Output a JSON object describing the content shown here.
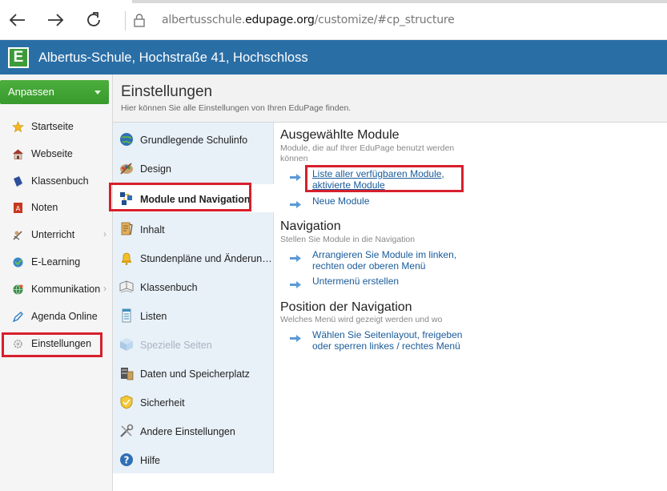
{
  "browser": {
    "url_prefix": "albertusschule.",
    "url_domain": "edupage.org",
    "url_path": "/customize/#cp_structure"
  },
  "header": {
    "logo_letter": "E",
    "school_title": "Albertus-Schule, Hochstraße 41, Hochschloss"
  },
  "sidebar": {
    "customize_label": "Anpassen",
    "items": [
      {
        "label": "Startseite",
        "icon": "star-icon"
      },
      {
        "label": "Webseite",
        "icon": "house-icon"
      },
      {
        "label": "Klassenbuch",
        "icon": "book-icon"
      },
      {
        "label": "Noten",
        "icon": "grades-icon"
      },
      {
        "label": "Unterricht",
        "icon": "teaching-icon"
      },
      {
        "label": "E-Learning",
        "icon": "elearning-icon"
      },
      {
        "label": "Kommunikation",
        "icon": "communication-icon"
      },
      {
        "label": "Agenda Online",
        "icon": "pen-icon"
      },
      {
        "label": "Einstellungen",
        "icon": "settings-icon"
      }
    ]
  },
  "main": {
    "title": "Einstellungen",
    "subtitle": "Hier können Sie alle Einstellungen von Ihren EduPage finden."
  },
  "settings_nav": {
    "items": [
      {
        "label": "Grundlegende Schulinfo",
        "icon": "globe-icon"
      },
      {
        "label": "Design",
        "icon": "palette-icon"
      },
      {
        "label": "Module und Navigation",
        "icon": "modules-icon"
      },
      {
        "label": "Inhalt",
        "icon": "content-icon"
      },
      {
        "label": "Stundenpläne und Änderun…",
        "icon": "bell-icon"
      },
      {
        "label": "Klassenbuch",
        "icon": "open-book-icon"
      },
      {
        "label": "Listen",
        "icon": "list-icon"
      },
      {
        "label": "Spezielle Seiten",
        "icon": "cube-icon"
      },
      {
        "label": "Daten und Speicherplatz",
        "icon": "storage-icon"
      },
      {
        "label": "Sicherheit",
        "icon": "shield-icon"
      },
      {
        "label": "Andere Einstellungen",
        "icon": "tools-icon"
      },
      {
        "label": "Hilfe",
        "icon": "help-icon"
      }
    ]
  },
  "content": {
    "modules": {
      "title": "Ausgewählte Module",
      "desc": "Module, die auf Ihrer EduPage benutzt werden können",
      "link1": "Liste aller verfügbaren Module, aktivierte Module",
      "link2": "Neue Module"
    },
    "navigation": {
      "title": "Navigation",
      "desc": "Stellen Sie Module in die Navigation",
      "link1": "Arrangieren Sie Module im linken, rechten oder oberen Menü",
      "link2": "Untermenü erstellen"
    },
    "position": {
      "title": "Position der Navigation",
      "desc": "Welches Menü wird gezeigt werden und wo",
      "link1": "Wählen Sie Seitenlayout, freigeben oder sperren linkes / rechtes Menü"
    }
  },
  "colors": {
    "header_blue": "#2a6ea6",
    "customize_green": "#3fa334",
    "link_blue": "#1a5b9a",
    "highlight_red": "#d71f2d"
  }
}
